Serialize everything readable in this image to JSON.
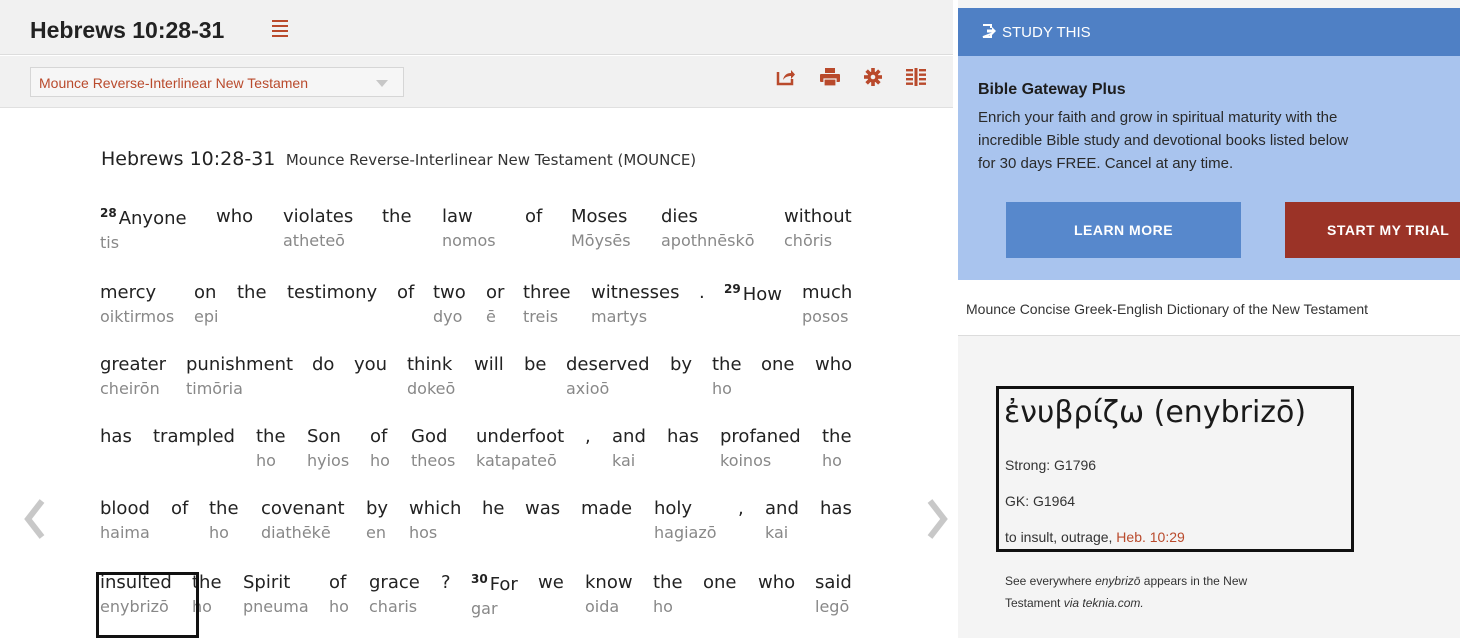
{
  "header": {
    "title": "Hebrews 10:28-31",
    "version_select": "Mounce Reverse-Interlinear New Testamen"
  },
  "toolbar": {
    "icons": [
      "share-icon",
      "print-icon",
      "gear-icon",
      "columns-icon"
    ]
  },
  "passage": {
    "reference": "Hebrews 10:28-31",
    "version": "Mounce Reverse-Interlinear New Testament (MOUNCE)",
    "lines": [
      [
        {
          "verse": "28",
          "en": "Anyone",
          "gr": "tis"
        },
        {
          "en": "who",
          "gr": ""
        },
        {
          "en": "violates",
          "gr": "atheteō"
        },
        {
          "en": "the",
          "gr": ""
        },
        {
          "en": "law",
          "gr": "nomos"
        },
        {
          "en": "of",
          "gr": ""
        },
        {
          "en": "Moses",
          "gr": "Mōysēs"
        },
        {
          "en": "dies",
          "gr": "apothnēskō"
        },
        {
          "en": "without",
          "gr": "chōris"
        }
      ],
      [
        {
          "en": "mercy",
          "gr": "oiktirmos"
        },
        {
          "en": "on",
          "gr": "epi"
        },
        {
          "en": "the",
          "gr": ""
        },
        {
          "en": "testimony",
          "gr": ""
        },
        {
          "en": "of",
          "gr": ""
        },
        {
          "en": "two",
          "gr": "dyo"
        },
        {
          "en": "or",
          "gr": "ē"
        },
        {
          "en": "three",
          "gr": "treis"
        },
        {
          "en": "witnesses",
          "gr": "martys"
        },
        {
          "en": ".",
          "gr": ""
        },
        {
          "verse": "29",
          "en": "How",
          "gr": ""
        },
        {
          "en": "much",
          "gr": "posos"
        }
      ],
      [
        {
          "en": "greater",
          "gr": "cheirōn"
        },
        {
          "en": "punishment",
          "gr": "timōria"
        },
        {
          "en": "do",
          "gr": ""
        },
        {
          "en": "you",
          "gr": ""
        },
        {
          "en": "think",
          "gr": "dokeō"
        },
        {
          "en": "will",
          "gr": ""
        },
        {
          "en": "be",
          "gr": ""
        },
        {
          "en": "deserved",
          "gr": "axioō"
        },
        {
          "en": "by",
          "gr": ""
        },
        {
          "en": "the",
          "gr": "ho"
        },
        {
          "en": "one",
          "gr": ""
        },
        {
          "en": "who",
          "gr": ""
        }
      ],
      [
        {
          "en": "has",
          "gr": ""
        },
        {
          "en": "trampled",
          "gr": ""
        },
        {
          "en": "the",
          "gr": "ho"
        },
        {
          "en": "Son",
          "gr": "hyios"
        },
        {
          "en": "of",
          "gr": "ho"
        },
        {
          "en": "God",
          "gr": "theos"
        },
        {
          "en": "underfoot",
          "gr": "katapateō"
        },
        {
          "en": ",",
          "gr": ""
        },
        {
          "en": "and",
          "gr": "kai"
        },
        {
          "en": "has",
          "gr": ""
        },
        {
          "en": "profaned",
          "gr": "koinos"
        },
        {
          "en": "the",
          "gr": "ho"
        }
      ],
      [
        {
          "en": "blood",
          "gr": "haima"
        },
        {
          "en": "of",
          "gr": ""
        },
        {
          "en": "the",
          "gr": "ho"
        },
        {
          "en": "covenant",
          "gr": "diathēkē"
        },
        {
          "en": "by",
          "gr": "en"
        },
        {
          "en": "which",
          "gr": "hos"
        },
        {
          "en": "he",
          "gr": ""
        },
        {
          "en": "was",
          "gr": ""
        },
        {
          "en": "made",
          "gr": ""
        },
        {
          "en": "holy",
          "gr": "hagiazō"
        },
        {
          "en": ",",
          "gr": ""
        },
        {
          "en": "and",
          "gr": "kai"
        },
        {
          "en": "has",
          "gr": ""
        }
      ],
      [
        {
          "en": "insulted",
          "gr": "enybrizō"
        },
        {
          "en": "the",
          "gr": "ho"
        },
        {
          "en": "Spirit",
          "gr": "pneuma"
        },
        {
          "en": "of",
          "gr": "ho"
        },
        {
          "en": "grace",
          "gr": "charis"
        },
        {
          "en": "?",
          "gr": ""
        },
        {
          "verse": "30",
          "en": "For",
          "gr": "gar"
        },
        {
          "en": "we",
          "gr": ""
        },
        {
          "en": "know",
          "gr": "oida"
        },
        {
          "en": "the",
          "gr": "ho"
        },
        {
          "en": "one",
          "gr": ""
        },
        {
          "en": "who",
          "gr": ""
        },
        {
          "en": "said",
          "gr": "legō"
        }
      ]
    ]
  },
  "study": {
    "header": "STUDY THIS",
    "promo_heading": "Bible Gateway Plus",
    "promo_text_lines": [
      "Enrich your faith and grow in spiritual maturity with the",
      "incredible Bible study and devotional books listed below",
      "for 30 days FREE. Cancel at any time."
    ],
    "learn_more": "LEARN MORE",
    "start_trial": "START MY TRIAL"
  },
  "dictionary": {
    "title": "Mounce Concise Greek-English Dictionary of the New Testament",
    "word": "ἐνυβρίζω (enybrizō)",
    "strong": "Strong: G1796",
    "gk": "GK: G1964",
    "definition": "to insult, outrage,",
    "reference": "Heb. 10:29",
    "see_prefix": "See everywhere",
    "see_word": "enybrizō",
    "see_mid": "appears in the New Testament",
    "see_via": "via",
    "see_site": "teknia.com."
  },
  "colors": {
    "accent": "#b94a2c",
    "study_header": "#4f80c5",
    "promo_bg": "#a9c4ee",
    "learn_more": "#5788cc",
    "start_trial": "#9b3327"
  }
}
